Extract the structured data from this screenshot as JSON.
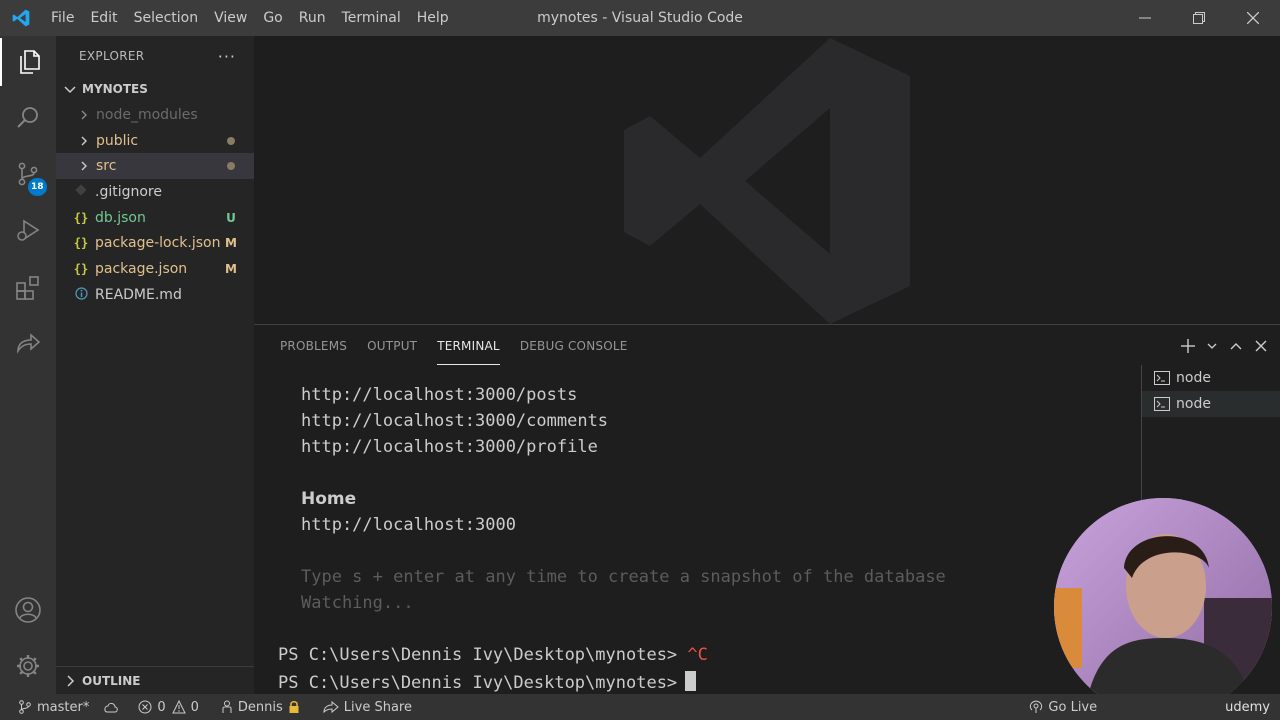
{
  "window": {
    "title": "mynotes - Visual Studio Code"
  },
  "menu": [
    "File",
    "Edit",
    "Selection",
    "View",
    "Go",
    "Run",
    "Terminal",
    "Help"
  ],
  "activity": {
    "scm_badge": "18"
  },
  "sidebar": {
    "header": "EXPLORER",
    "more": "···",
    "folder": "MYNOTES",
    "items": [
      {
        "label": "node_modules",
        "type": "folder",
        "color": "#6b6b6b",
        "deco": ""
      },
      {
        "label": "public",
        "type": "folder",
        "color": "#e2c08d",
        "deco": "dot"
      },
      {
        "label": "src",
        "type": "folder",
        "color": "#e2c08d",
        "deco": "dot"
      },
      {
        "label": ".gitignore",
        "type": "file",
        "icon": "git-icon",
        "color": "#cccccc",
        "deco": ""
      },
      {
        "label": "db.json",
        "type": "file",
        "icon": "json-icon",
        "color": "#73c991",
        "deco": "U"
      },
      {
        "label": "package-lock.json",
        "type": "file",
        "icon": "json-icon",
        "color": "#e2c08d",
        "deco": "M"
      },
      {
        "label": "package.json",
        "type": "file",
        "icon": "json-icon",
        "color": "#e2c08d",
        "deco": "M"
      },
      {
        "label": "README.md",
        "type": "file",
        "icon": "info-icon",
        "color": "#cccccc",
        "deco": ""
      }
    ],
    "outline": "OUTLINE"
  },
  "panel": {
    "tabs": [
      "PROBLEMS",
      "OUTPUT",
      "TERMINAL",
      "DEBUG CONSOLE"
    ],
    "active_tab": "TERMINAL",
    "terminal_lines": {
      "l1": "http://localhost:3000/posts",
      "l2": "http://localhost:3000/comments",
      "l3": "http://localhost:3000/profile",
      "home": "Home",
      "l4": "http://localhost:3000",
      "hint": "Type s + enter at any time to create a snapshot of the database",
      "watching": "Watching...",
      "prompt1": "PS C:\\Users\\Dennis Ivy\\Desktop\\mynotes>",
      "ctrl_c": "^C",
      "prompt2": "PS C:\\Users\\Dennis Ivy\\Desktop\\mynotes>"
    },
    "terminals": [
      "node",
      "node"
    ]
  },
  "statusbar": {
    "branch": "master*",
    "errors": "0",
    "warnings": "0",
    "user": "Dennis",
    "live_share": "Live Share",
    "go_live": "Go Live",
    "watermark": "udemy"
  }
}
